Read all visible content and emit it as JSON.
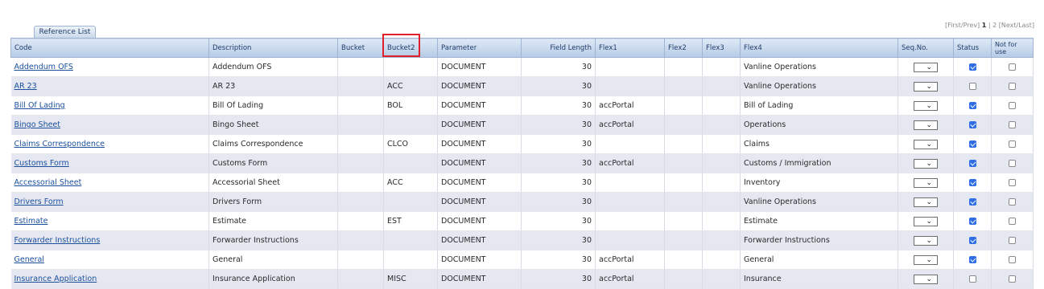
{
  "pager": {
    "first_prev": "[First/Prev]",
    "page1": "1",
    "sep": "|",
    "page2": "2",
    "next_last": "[Next/Last]"
  },
  "tab_label": "Reference List",
  "columns": {
    "code": "Code",
    "description": "Description",
    "bucket": "Bucket",
    "bucket2": "Bucket2",
    "parameter": "Parameter",
    "field_length": "Field Length",
    "flex1": "Flex1",
    "flex2": "Flex2",
    "flex3": "Flex3",
    "flex4": "Flex4",
    "seq_no": "Seq.No.",
    "status": "Status",
    "not_for_use": "Not for use"
  },
  "rows": [
    {
      "code": "Addendum OFS",
      "description": "Addendum OFS",
      "bucket": "",
      "bucket2": "",
      "parameter": "DOCUMENT",
      "field_length": "30",
      "flex1": "",
      "flex2": "",
      "flex3": "",
      "flex4": "Vanline Operations",
      "status": true,
      "not_for_use": false
    },
    {
      "code": "AR 23",
      "description": "AR 23",
      "bucket": "",
      "bucket2": "ACC",
      "parameter": "DOCUMENT",
      "field_length": "30",
      "flex1": "",
      "flex2": "",
      "flex3": "",
      "flex4": "Vanline Operations",
      "status": false,
      "not_for_use": false
    },
    {
      "code": "Bill Of Lading",
      "description": "Bill Of Lading",
      "bucket": "",
      "bucket2": "BOL",
      "parameter": "DOCUMENT",
      "field_length": "30",
      "flex1": "accPortal",
      "flex2": "",
      "flex3": "",
      "flex4": "Bill of Lading",
      "status": true,
      "not_for_use": false
    },
    {
      "code": "Bingo Sheet",
      "description": "Bingo Sheet",
      "bucket": "",
      "bucket2": "",
      "parameter": "DOCUMENT",
      "field_length": "30",
      "flex1": "accPortal",
      "flex2": "",
      "flex3": "",
      "flex4": "Operations",
      "status": true,
      "not_for_use": false
    },
    {
      "code": "Claims Correspondence",
      "description": "Claims Correspondence",
      "bucket": "",
      "bucket2": "CLCO",
      "parameter": "DOCUMENT",
      "field_length": "30",
      "flex1": "",
      "flex2": "",
      "flex3": "",
      "flex4": "Claims",
      "status": true,
      "not_for_use": false
    },
    {
      "code": "Customs Form",
      "description": "Customs Form",
      "bucket": "",
      "bucket2": "",
      "parameter": "DOCUMENT",
      "field_length": "30",
      "flex1": "accPortal",
      "flex2": "",
      "flex3": "",
      "flex4": "Customs / Immigration",
      "status": true,
      "not_for_use": false
    },
    {
      "code": "Accessorial Sheet",
      "description": "Accessorial Sheet",
      "bucket": "",
      "bucket2": "ACC",
      "parameter": "DOCUMENT",
      "field_length": "30",
      "flex1": "",
      "flex2": "",
      "flex3": "",
      "flex4": "Inventory",
      "status": true,
      "not_for_use": false
    },
    {
      "code": "Drivers Form",
      "description": "Drivers Form",
      "bucket": "",
      "bucket2": "",
      "parameter": "DOCUMENT",
      "field_length": "30",
      "flex1": "",
      "flex2": "",
      "flex3": "",
      "flex4": "Vanline Operations",
      "status": true,
      "not_for_use": false
    },
    {
      "code": "Estimate",
      "description": "Estimate",
      "bucket": "",
      "bucket2": "EST",
      "parameter": "DOCUMENT",
      "field_length": "30",
      "flex1": "",
      "flex2": "",
      "flex3": "",
      "flex4": "Estimate",
      "status": true,
      "not_for_use": false
    },
    {
      "code": "Forwarder Instructions",
      "description": "Forwarder Instructions",
      "bucket": "",
      "bucket2": "",
      "parameter": "DOCUMENT",
      "field_length": "30",
      "flex1": "",
      "flex2": "",
      "flex3": "",
      "flex4": "Forwarder Instructions",
      "status": true,
      "not_for_use": false
    },
    {
      "code": "General",
      "description": "General",
      "bucket": "",
      "bucket2": "",
      "parameter": "DOCUMENT",
      "field_length": "30",
      "flex1": "accPortal",
      "flex2": "",
      "flex3": "",
      "flex4": "General",
      "status": true,
      "not_for_use": false
    },
    {
      "code": "Insurance Application",
      "description": "Insurance Application",
      "bucket": "",
      "bucket2": "MISC",
      "parameter": "DOCUMENT",
      "field_length": "30",
      "flex1": "accPortal",
      "flex2": "",
      "flex3": "",
      "flex4": "Insurance",
      "status": false,
      "not_for_use": false
    }
  ],
  "colors": {
    "header_top": "#dfe9f6",
    "header_bottom": "#b6cbe6",
    "alt_row": "#e6e8f1",
    "link": "#1a4f9c",
    "highlight": "#e0202a",
    "checkbox": "#2f6ee6"
  }
}
